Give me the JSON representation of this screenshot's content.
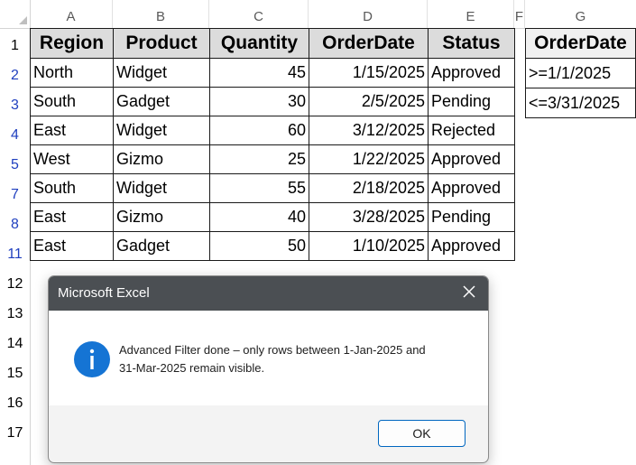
{
  "columns": [
    "A",
    "B",
    "C",
    "D",
    "E",
    "F",
    "G"
  ],
  "rows": [
    "1",
    "2",
    "3",
    "4",
    "5",
    "7",
    "8",
    "11",
    "12",
    "13",
    "14",
    "15",
    "16",
    "17"
  ],
  "table": {
    "headers": [
      "Region",
      "Product",
      "Quantity",
      "OrderDate",
      "Status"
    ],
    "records": [
      [
        "North",
        "Widget",
        "45",
        "1/15/2025",
        "Approved"
      ],
      [
        "South",
        "Gadget",
        "30",
        "2/5/2025",
        "Pending"
      ],
      [
        "East",
        "Widget",
        "60",
        "3/12/2025",
        "Rejected"
      ],
      [
        "West",
        "Gizmo",
        "25",
        "1/22/2025",
        "Approved"
      ],
      [
        "South",
        "Widget",
        "55",
        "2/18/2025",
        "Approved"
      ],
      [
        "East",
        "Gizmo",
        "40",
        "3/28/2025",
        "Pending"
      ],
      [
        "East",
        "Gadget",
        "50",
        "1/10/2025",
        "Approved"
      ]
    ]
  },
  "criteria": {
    "header": "OrderDate",
    "values": [
      ">=1/1/2025",
      "<=3/31/2025"
    ]
  },
  "dialog": {
    "title": "Microsoft Excel",
    "message_line1": "Advanced Filter done – only rows between 1-Jan-2025 and",
    "message_line2": "31-Mar-2025 remain visible.",
    "ok_label": "OK"
  },
  "colors": {
    "filtered_row_number": "#1f3fbf",
    "dialog_titlebar": "#4b4f53",
    "info_icon": "#1574d4",
    "ok_border": "#0067c0"
  },
  "icons": {
    "info": "info-icon",
    "close": "close-icon"
  }
}
